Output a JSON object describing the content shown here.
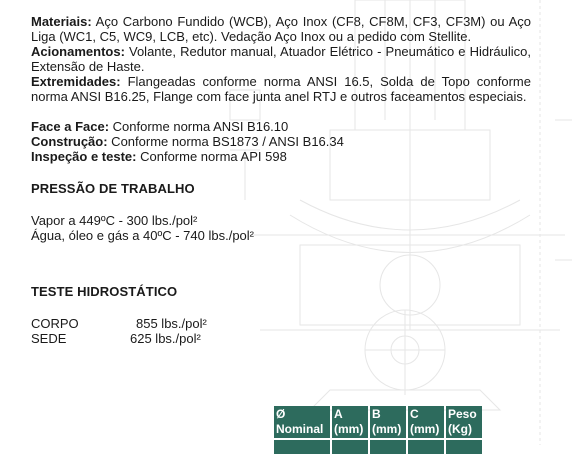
{
  "specs": {
    "materiais": {
      "label": "Materiais:",
      "text": " Aço Carbono Fundido (WCB), Aço Inox (CF8, CF8M, CF3, CF3M) ou Aço Liga (WC1, C5, WC9, LCB, etc). Vedação Aço Inox ou a pedido com Stellite."
    },
    "acionamentos": {
      "label": "Acionamentos:",
      "text": " Volante, Redutor manual, Atuador Elétrico - Pneumático e Hidráulico, Extensão de Haste."
    },
    "extremidades": {
      "label": "Extremidades:",
      "text": " Flangeadas conforme norma ANSI 16.5, Solda de Topo conforme norma ANSI B16.25, Flange com face junta anel RTJ e outros faceamentos especiais."
    },
    "face_a_face": {
      "label": "Face a Face:",
      "text": " Conforme norma ANSI B16.10"
    },
    "construcao": {
      "label": "Construção:",
      "text": " Conforme norma BS1873 / ANSI B16.34"
    },
    "inspecao": {
      "label": "Inspeção e teste:",
      "text": " Conforme norma API 598"
    }
  },
  "pressao": {
    "heading": "PRESSÃO DE TRABALHO",
    "lines": [
      "Vapor a 449ºC - 300 lbs./pol²",
      "Água, óleo e gás a 40ºC - 740 lbs./pol²"
    ]
  },
  "teste": {
    "heading": "TESTE HIDROSTÁTICO",
    "rows": [
      {
        "label": "CORPO",
        "value": "855 lbs./pol²"
      },
      {
        "label": "SEDE",
        "value": "625 lbs./pol²"
      }
    ]
  },
  "table": {
    "headers": [
      [
        "Ø",
        "Nominal"
      ],
      [
        "A",
        "(mm)"
      ],
      [
        "B",
        "(mm)"
      ],
      [
        "C",
        "(mm)"
      ],
      [
        "Peso",
        "(Kg)"
      ]
    ]
  },
  "colors": {
    "table_header_bg": "#2d6b5d",
    "table_header_text": "#ffffff",
    "body_text": "#1a1a1a"
  }
}
